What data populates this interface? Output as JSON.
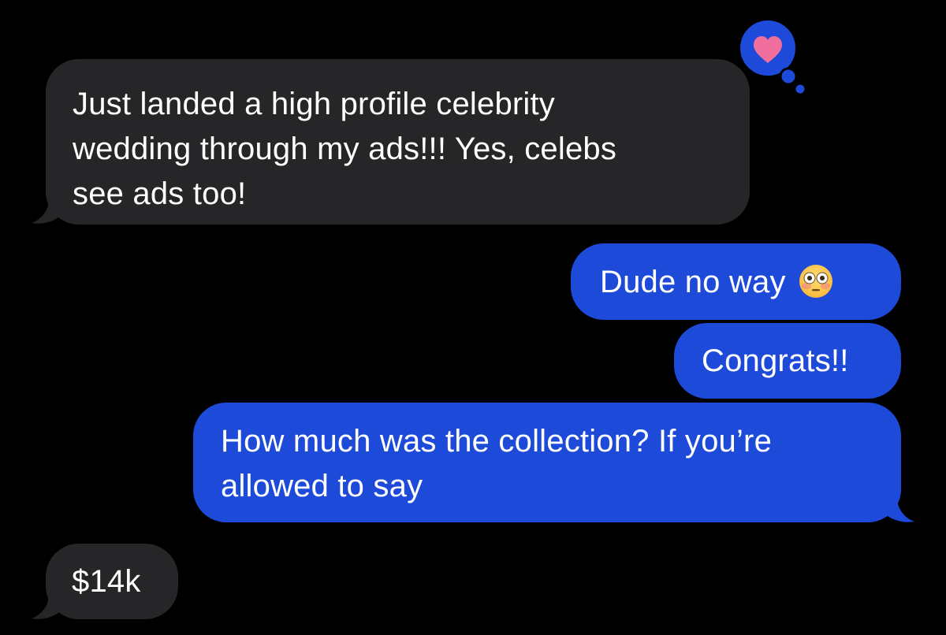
{
  "conversation": {
    "messages": [
      {
        "direction": "incoming",
        "text": "Just landed a high profile celebrity\nwedding through my ads!!! Yes, celebs\nsee ads too!",
        "reaction": "heart-icon"
      },
      {
        "direction": "outgoing",
        "text": "Dude no way",
        "emoji": "flushed-face-icon"
      },
      {
        "direction": "outgoing",
        "text": "Congrats!!"
      },
      {
        "direction": "outgoing",
        "text": "How much was the collection? If you’re\nallowed to say"
      },
      {
        "direction": "incoming",
        "text": "$14k"
      }
    ]
  },
  "colors": {
    "background": "#000000",
    "incoming_bubble": "#262628",
    "outgoing_bubble": "#1d4ad8",
    "heart": "#f06f9c",
    "text": "#ffffff"
  }
}
